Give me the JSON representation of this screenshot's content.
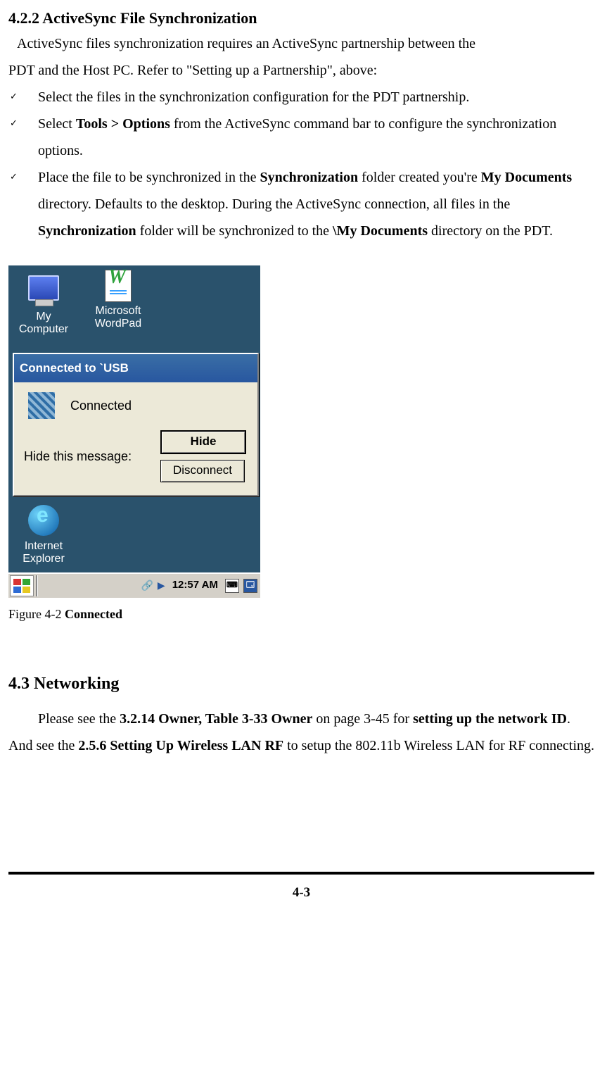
{
  "section422": {
    "heading": "4.2.2 ActiveSync File Synchronization",
    "intro1": "ActiveSync files synchronization requires an ActiveSync partnership between the",
    "intro2": "PDT and the Host PC. Refer to \"Setting up a Partnership\", above:",
    "items": [
      {
        "full": "Select the files in the synchronization configuration for the PDT partnership."
      },
      {
        "pre": "Select ",
        "bold": "Tools > Options",
        "post": " from the ActiveSync command bar to configure the synchronization options."
      },
      {
        "pre": "Place the file to be synchronized in the ",
        "b1": "Synchronization",
        "mid1": " folder created you're ",
        "b2": "My Documents",
        "mid2": " directory. Defaults to the desktop. During the ActiveSync connection, all files in the ",
        "b3": "Synchronization",
        "mid3": " folder will be synchronized to the ",
        "b4": "\\My Documents",
        "post": " directory on the PDT."
      }
    ]
  },
  "screenshot": {
    "desktop_icons": {
      "mycomputer_l1": "My",
      "mycomputer_l2": "Computer",
      "wordpad_l1": "Microsoft",
      "wordpad_l2": "WordPad",
      "ie_l1": "Internet",
      "ie_l2": "Explorer"
    },
    "popup": {
      "title": "Connected to `USB",
      "status": "Connected",
      "hide_label": "Hide this message:",
      "btn_hide": "Hide",
      "btn_disconnect": "Disconnect"
    },
    "taskbar": {
      "clock": "12:57 AM"
    }
  },
  "figure": {
    "label_pre": "Figure 4-2 ",
    "label_bold": "Connected"
  },
  "section43": {
    "heading": "4.3 Networking",
    "t1": "Please see the ",
    "b1": "3.2.14 Owner, Table 3-33 Owner",
    "t2": " on page 3-45 for ",
    "b2": "setting up the network ID",
    "t3": ". And see the ",
    "b3": "2.5.6 Setting Up Wireless LAN RF",
    "t4": " to setup the 802.11b Wireless LAN for RF connecting."
  },
  "page_number": "4-3"
}
